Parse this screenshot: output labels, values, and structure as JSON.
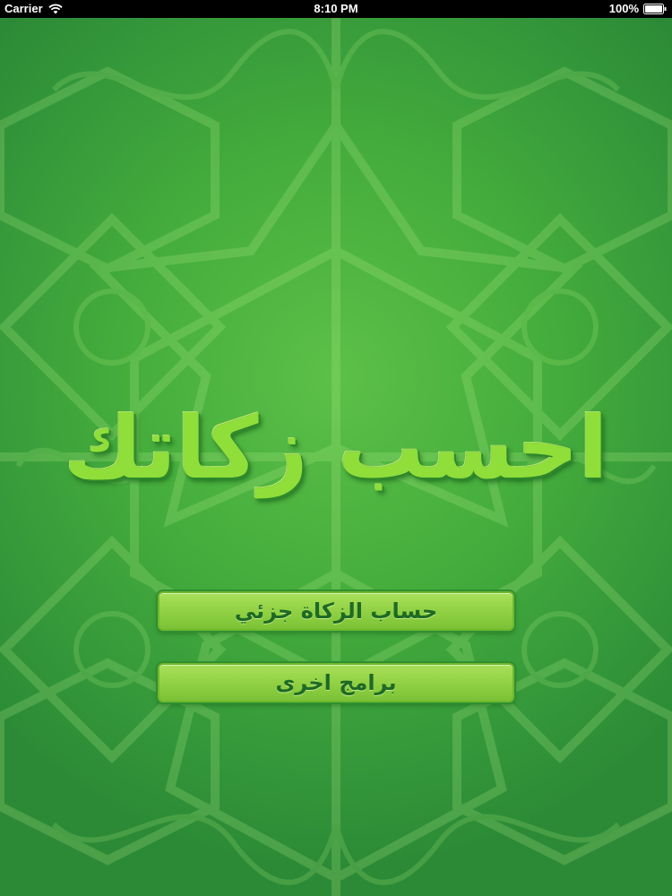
{
  "status_bar": {
    "carrier": "Carrier",
    "time": "8:10 PM",
    "battery": "100%"
  },
  "app": {
    "title": "احسب زكاتك"
  },
  "menu": {
    "partial_zakat_label": "حساب الزكاة جزئي",
    "other_apps_label": "برامج اخرى"
  },
  "colors": {
    "background": "#45ad3c",
    "button_fill": "#8fd042",
    "button_text": "#1e6a24",
    "title_text": "#8fde3a"
  },
  "icons": [
    "wifi-icon",
    "battery-icon"
  ]
}
